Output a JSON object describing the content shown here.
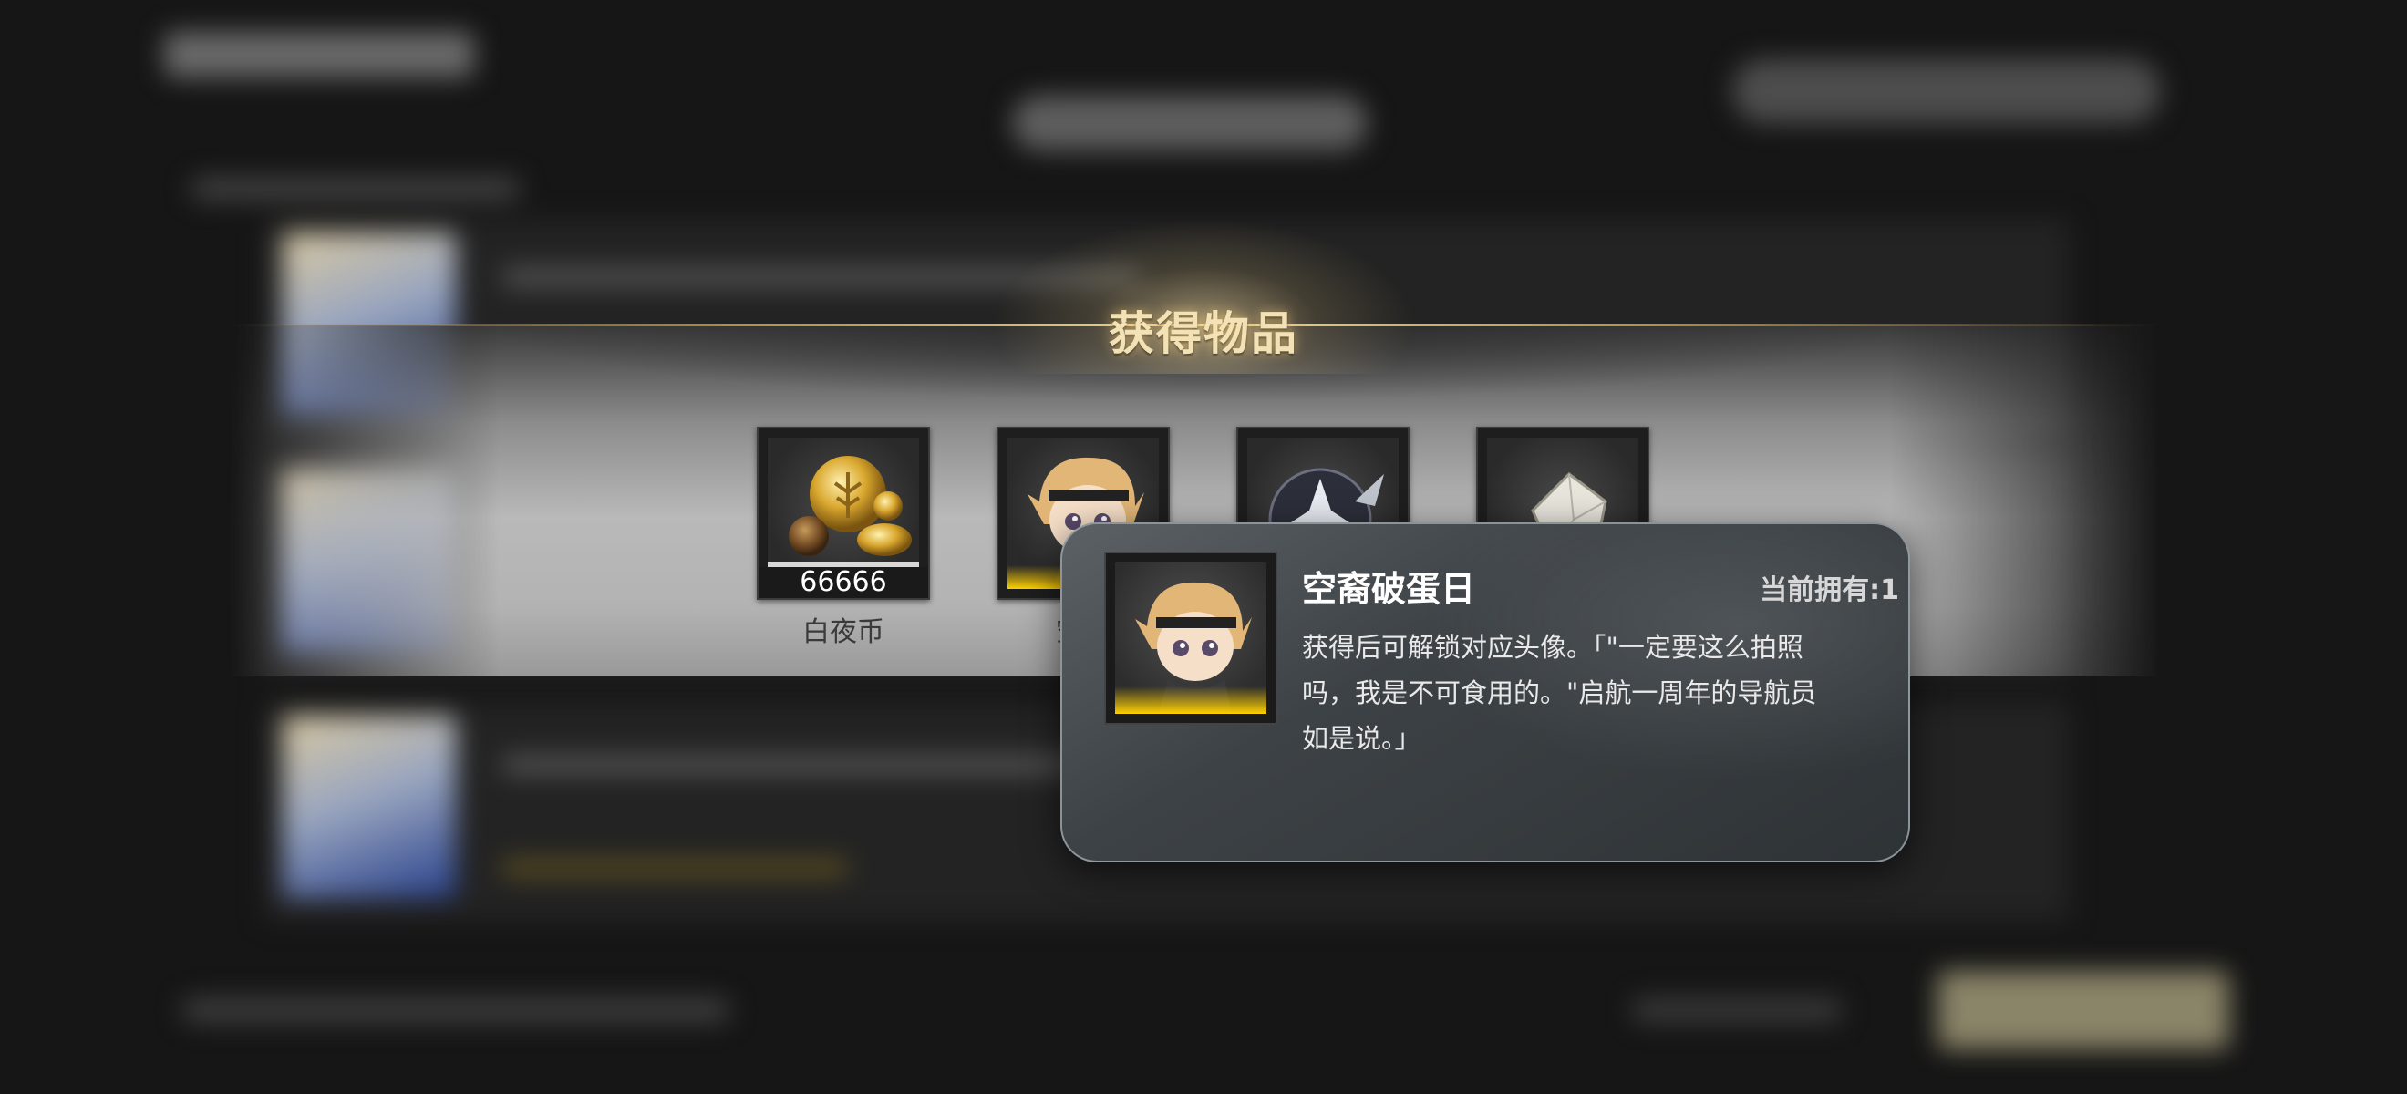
{
  "reward_popup": {
    "title": "获得物品",
    "items": [
      {
        "name": "白夜币",
        "quantity": "66666",
        "icon": "coin-icon"
      },
      {
        "name": "空裔",
        "quantity": "",
        "icon": "chibi-avatar-icon"
      },
      {
        "name": "",
        "quantity": "",
        "icon": "emblem-icon"
      },
      {
        "name": "",
        "quantity": "",
        "icon": "crystal-icon"
      }
    ]
  },
  "tooltip": {
    "item_name": "空裔破蛋日",
    "owned": "当前拥有:1",
    "description": "获得后可解锁对应头像。「\"一定要这么拍照吗，我是不可食用的。\"启航一周年的导航员如是说。」",
    "icon": "chibi-avatar-icon",
    "rarity_color": "#ffcf00"
  },
  "colors": {
    "gold_accent": "#f1d58f",
    "background": "#161616"
  }
}
